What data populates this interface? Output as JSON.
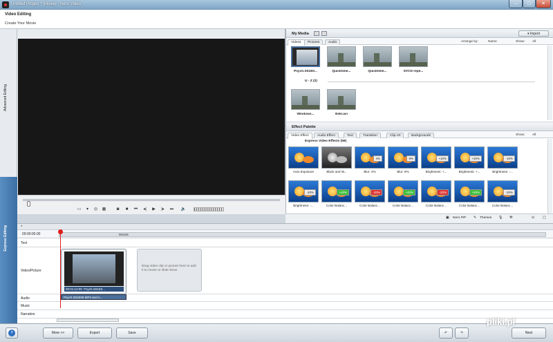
{
  "window": {
    "title": "Untitled Project * [Movie] - Nero Video"
  },
  "header": {
    "title": "Video Editing",
    "subtitle": "Create Your Movie"
  },
  "side_tabs": {
    "advanced": "Advanced Editing",
    "express": "Express Editing"
  },
  "my_media": {
    "title": "My Media",
    "import_label": "Import",
    "tabs": [
      "Videos",
      "Pictures",
      "Audio"
    ],
    "arrange_label": "Arrange by:",
    "arrange_value": "Name",
    "show_label": "Show:",
    "show_value": "All",
    "items": [
      "Psych.S01E0...",
      "Quicktime...",
      "Quicktime...",
      "SVCD repe...",
      "Windows...",
      "Eekl.avi"
    ],
    "section_label": "U - Z (2)"
  },
  "effects": {
    "title": "Effect Palette",
    "tabs": [
      "Video Effect",
      "Audio Effect",
      "Text",
      "Transition",
      "Clip Art",
      "Backgrounds"
    ],
    "show_label": "Show:",
    "show_value": "All",
    "group_title": "Express Video Effects (59)",
    "items": [
      {
        "label": "Auto Exposure",
        "badge": "",
        "bw": false
      },
      {
        "label": "Black and W...",
        "badge": "",
        "bw": true
      },
      {
        "label": "Blur: 4%",
        "badge": "4%",
        "bw": false
      },
      {
        "label": "Blur: 8%",
        "badge": "8%",
        "bw": false
      },
      {
        "label": "Brightness: +...",
        "badge": "+10%",
        "bw": false
      },
      {
        "label": "Brightness: +...",
        "badge": "+20%",
        "bw": false
      },
      {
        "label": "Brightness: -...",
        "badge": "-10%",
        "bw": false
      },
      {
        "label": "Brightness: -...",
        "badge": "-20%",
        "bw": false
      },
      {
        "label": "Color Balanc...",
        "badge": "+40%",
        "bw": false
      },
      {
        "label": "Color Balanc...",
        "badge": "-20%",
        "bw": false
      },
      {
        "label": "Color Balanc...",
        "badge": "+40%",
        "bw": false
      },
      {
        "label": "Color Balanc...",
        "badge": "-20%",
        "bw": false
      },
      {
        "label": "Color Balanc...",
        "badge": "+40%",
        "bw": false
      },
      {
        "label": "Color Balanc...",
        "badge": "-20%",
        "bw": false
      }
    ],
    "footer_nero_pip": "Nero PiP",
    "footer_themes": "Themes"
  },
  "timeline": {
    "current_time": "00:00:00.00",
    "ruler_mark": "0m10s",
    "tracks": [
      "Text",
      "Video/Picture",
      "Audio",
      "Music",
      "Narration"
    ],
    "clip_caption": "00:01:12:00",
    "clip_name": "Psych.S01E0...",
    "audio_clip": "Psych.S01E06 MP4 and A...",
    "drop_hint": "Drag video clip or picture here to add it to movie or slide show"
  },
  "bottom": {
    "more": "More >>",
    "export": "Export",
    "save": "Save",
    "next": "Next"
  },
  "watermark": "pliki.pl"
}
